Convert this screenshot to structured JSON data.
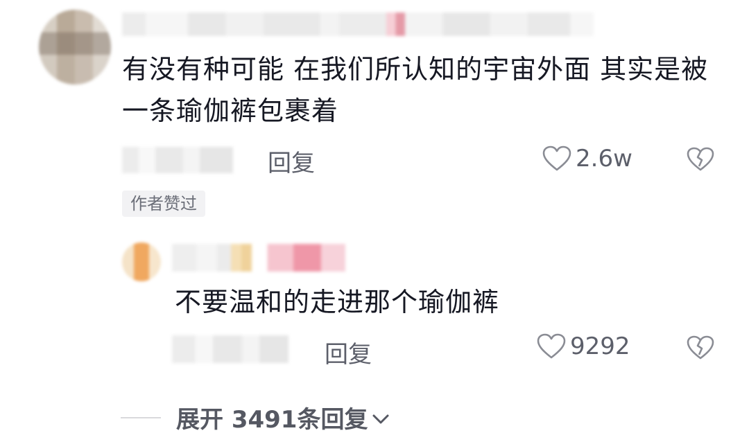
{
  "comment": {
    "text": "有没有种可能 在我们所认知的宇宙外面 其实是被一条瑜伽裤包裹着",
    "reply_label": "回复",
    "like_count": "2.6w",
    "author_badge": "作者赞过"
  },
  "reply": {
    "text": "不要温和的走进那个瑜伽裤",
    "reply_label": "回复",
    "like_count": "9292"
  },
  "expand": {
    "label": "展开 3491条回复"
  },
  "colors": {
    "primary_text": "#161823",
    "secondary_text": "#5c5f6a",
    "badge_bg": "#f2f2f4"
  },
  "icons": [
    "heart-outline-icon",
    "broken-heart-icon",
    "chevron-down-icon"
  ]
}
